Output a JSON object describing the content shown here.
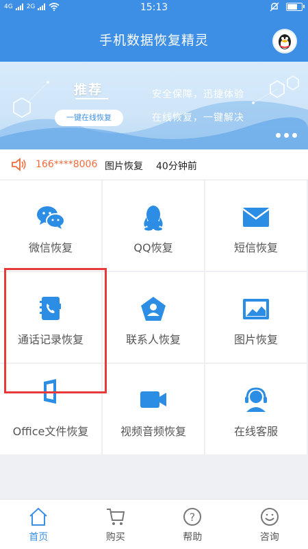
{
  "status": {
    "signal1": "4G",
    "signal2": "2G",
    "time": "15:13"
  },
  "header": {
    "title": "手机数据恢复精灵",
    "avatar_icon": "qq-penguin-icon"
  },
  "banner": {
    "tag": "推荐",
    "button_label": "一键在线恢复",
    "line1": "安全保障，迅捷体验",
    "line2": "在线恢复，一键解决"
  },
  "notice": {
    "icon": "speaker-icon",
    "phone": "166****8006",
    "type": "图片恢复",
    "ago": "40分钟前",
    "accent": "#f26b3a"
  },
  "grid": [
    {
      "label": "微信恢复",
      "icon": "wechat-icon"
    },
    {
      "label": "QQ恢复",
      "icon": "qq-icon"
    },
    {
      "label": "短信恢复",
      "icon": "envelope-icon"
    },
    {
      "label": "通话记录恢复",
      "icon": "call-log-icon"
    },
    {
      "label": "联系人恢复",
      "icon": "contact-icon"
    },
    {
      "label": "图片恢复",
      "icon": "image-icon"
    },
    {
      "label": "Office文件恢复",
      "icon": "office-icon"
    },
    {
      "label": "视频音频恢复",
      "icon": "video-icon"
    },
    {
      "label": "在线客服",
      "icon": "headset-icon"
    }
  ],
  "nav": [
    {
      "label": "首页",
      "icon": "home-icon",
      "active": true
    },
    {
      "label": "购买",
      "icon": "cart-icon",
      "active": false
    },
    {
      "label": "帮助",
      "icon": "help-icon",
      "active": false
    },
    {
      "label": "咨询",
      "icon": "smile-icon",
      "active": false
    }
  ],
  "colors": {
    "primary": "#3d8fe6",
    "highlight_border": "#e63a3a"
  }
}
